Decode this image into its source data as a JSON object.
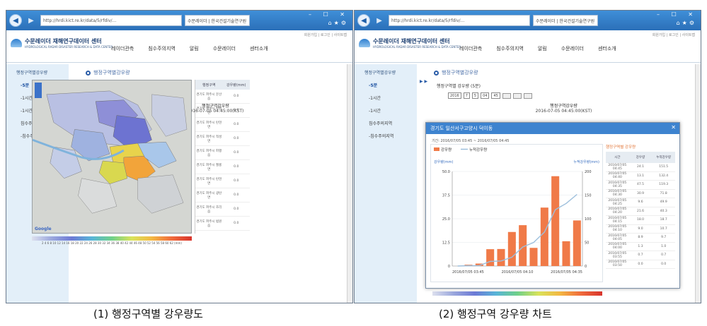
{
  "left": {
    "address": "http://hrdi.kict.re.kr/data/5/rfdiv/...",
    "tab": "수문레이더 | 한국건설기술연구원",
    "logo": {
      "ko": "수문레이더 재해연구데이터 센터",
      "en": "HYDROLOGICAL RADAR DISASTER RESEARCH & DATA CENTER"
    },
    "util": "회원가입 | 로그인 | 사이트맵",
    "nav": [
      "레이더관측",
      "침수주의지역",
      "알림",
      "수문레이더",
      "센터소개"
    ],
    "sidebar": {
      "title": "행정구역별강우량",
      "items": [
        "-5분",
        "-1시간",
        "-1시간",
        "침수주의지역",
        "-침수주의지역"
      ]
    },
    "breadcrumb": "행정구역별강우량",
    "subhead": "행정구역별 강우량 (5분)",
    "controls": {
      "year": "2016",
      "month": "7",
      "day": "5",
      "hour": "04",
      "minute": "45"
    },
    "map_title": "행정구역강우량",
    "map_time": "2016-07-05 04:45:00(KST)",
    "table_head": [
      "행정구역",
      "강우량(mm)"
    ],
    "table_rows": [
      [
        "경기도 파주시 문산읍",
        "0.0"
      ],
      [
        "경기도 파주시 파평면",
        "0.0"
      ],
      [
        "경기도 파주시 탄현면",
        "0.0"
      ],
      [
        "경기도 파주시 적성면",
        "0.0"
      ],
      [
        "경기도 파주시 파평읍",
        "0.0"
      ],
      [
        "경기도 파주시 월롱면",
        "0.0"
      ],
      [
        "경기도 파주시 탄현면",
        "0.0"
      ],
      [
        "경기도 파주시 광탄면",
        "0.0"
      ],
      [
        "경기도 파주시 조리읍",
        "0.0"
      ],
      [
        "경기도 파주시 법원읍",
        "0.0"
      ]
    ],
    "legend": "2 4 6 8 10 12 14 16 18 20 22 24 26 28 30 32 34 36 38 40 42 44 46 48 50 52 54 56 58 60 62 (mm)"
  },
  "right": {
    "popup": {
      "title": "경기도 일산서구고양시 덕이동",
      "period": "기간: 2016/07/05 03:45 ~ 2016/07/05 04:45",
      "close": "✕"
    },
    "side_table": {
      "title": "행정구역별 강우량",
      "head": [
        "시간",
        "강우량",
        "누적강우량"
      ],
      "rows": [
        [
          "2016/07/05 04:45",
          "24.1",
          "151.5"
        ],
        [
          "2016/07/05 04:40",
          "13.1",
          "132.4"
        ],
        [
          "2016/07/05 04:35",
          "47.5",
          "119.3"
        ],
        [
          "2016/07/05 04:30",
          "30.9",
          "71.8"
        ],
        [
          "2016/07/05 04:25",
          "9.6",
          "49.9"
        ],
        [
          "2016/07/05 04:20",
          "21.6",
          "40.3"
        ],
        [
          "2016/07/05 04:15",
          "18.0",
          "18.7"
        ],
        [
          "2016/07/05 04:10",
          "9.0",
          "10.7"
        ],
        [
          "2016/07/05 04:05",
          "8.9",
          "9.7"
        ],
        [
          "2016/07/05 04:00",
          "1.3",
          "1.0"
        ],
        [
          "2016/07/05 03:55",
          "0.7",
          "0.7"
        ],
        [
          "2016/07/05 03:50",
          "0.0",
          "0.0"
        ]
      ]
    }
  },
  "chart_data": {
    "type": "bar",
    "title": "",
    "legend": [
      "강우량",
      "누적강우량"
    ],
    "ylabel": "강우량(mm)",
    "y2label": "누적강우량(mm)",
    "ylim": [
      0,
      50
    ],
    "y2lim": [
      0,
      200
    ],
    "yticks": [
      "0",
      "12.5",
      "25.0",
      "37.5",
      "50.0"
    ],
    "y2ticks": [
      "0",
      "50",
      "100",
      "150",
      "200"
    ],
    "x_tick_labels": [
      "2016/07/05 03:45",
      "2016/07/05 04:10",
      "2016/07/05 04:35"
    ],
    "categories": [
      "03:50",
      "03:55",
      "04:00",
      "04:05",
      "04:10",
      "04:15",
      "04:20",
      "04:25",
      "04:30",
      "04:35",
      "04:40",
      "04:45"
    ],
    "series": [
      {
        "name": "강우량",
        "values": [
          0.0,
          0.7,
          1.3,
          8.9,
          9.0,
          18.0,
          21.6,
          9.6,
          30.9,
          47.5,
          13.1,
          24.1
        ]
      },
      {
        "name": "누적강우량",
        "values": [
          0.0,
          0.7,
          1.0,
          9.7,
          10.7,
          18.7,
          40.3,
          49.9,
          71.8,
          119.3,
          132.4,
          151.5
        ]
      }
    ],
    "bar_color": "#f07a48",
    "line_color": "#9dbfdc"
  },
  "captions": {
    "left": "(1) 행정구역별 강우량도",
    "right": "(2) 행정구역 강우량 차트"
  }
}
